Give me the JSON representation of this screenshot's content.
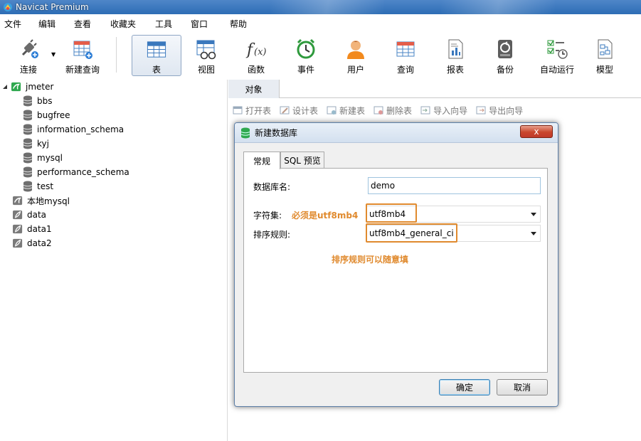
{
  "window": {
    "title": "Navicat Premium"
  },
  "menu": [
    "文件",
    "编辑",
    "查看",
    "收藏夹",
    "工具",
    "窗口",
    "帮助"
  ],
  "toolbar": [
    {
      "label": "连接",
      "icon": "plug-icon"
    },
    {
      "label": "新建查询",
      "icon": "new-query-icon"
    },
    {
      "label": "表",
      "icon": "table-icon"
    },
    {
      "label": "视图",
      "icon": "view-icon"
    },
    {
      "label": "函数",
      "icon": "function-icon"
    },
    {
      "label": "事件",
      "icon": "alarm-clock-icon"
    },
    {
      "label": "用户",
      "icon": "user-icon"
    },
    {
      "label": "查询",
      "icon": "query-icon"
    },
    {
      "label": "报表",
      "icon": "report-icon"
    },
    {
      "label": "备份",
      "icon": "backup-icon"
    },
    {
      "label": "自动运行",
      "icon": "schedule-icon"
    },
    {
      "label": "模型",
      "icon": "model-icon"
    }
  ],
  "tree": {
    "connection": "jmeter",
    "databases": [
      "bbs",
      "bugfree",
      "information_schema",
      "kyj",
      "mysql",
      "performance_schema",
      "test"
    ],
    "other_connections": [
      "本地mysql",
      "data",
      "data1",
      "data2"
    ]
  },
  "tab": {
    "objects": "对象"
  },
  "objects_toolbar": [
    "打开表",
    "设计表",
    "新建表",
    "删除表",
    "导入向导",
    "导出向导"
  ],
  "dialog": {
    "title": "新建数据库",
    "close": "x",
    "tabs": [
      "常规",
      "SQL 预览"
    ],
    "db_name_label": "数据库名:",
    "db_name_value": "demo",
    "charset_label": "字符集:",
    "charset_note": "必须是utf8mb4",
    "charset_value": "utf8mb4",
    "collation_label": "排序规则:",
    "collation_value": "utf8mb4_general_ci",
    "collation_note": "排序规则可以随意填",
    "ok": "确定",
    "cancel": "取消"
  },
  "colors": {
    "highlight": "#e08a2e",
    "titlebar": "#2d6db5"
  }
}
